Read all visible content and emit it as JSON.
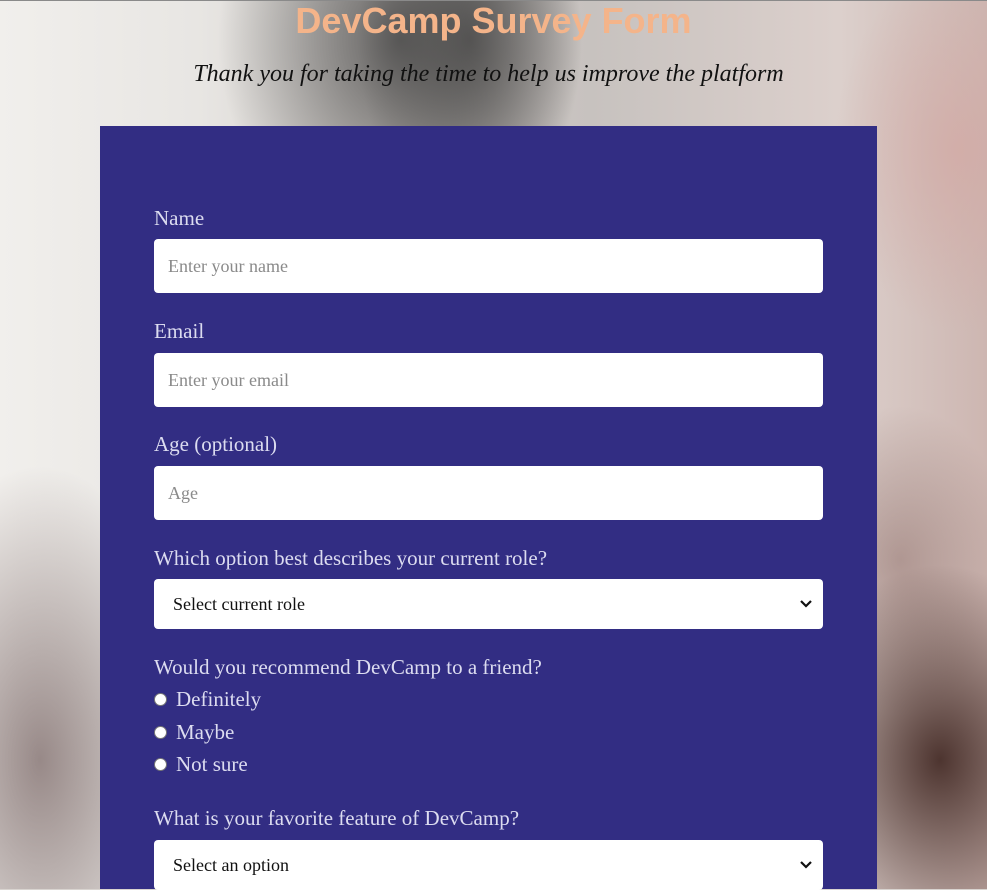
{
  "header": {
    "title": "DevCamp Survey Form",
    "subtitle": "Thank you for taking the time to help us improve the platform"
  },
  "form": {
    "name": {
      "label": "Name",
      "placeholder": "Enter your name"
    },
    "email": {
      "label": "Email",
      "placeholder": "Enter your email"
    },
    "age": {
      "label": "Age (optional)",
      "placeholder": "Age"
    },
    "role": {
      "label": "Which option best describes your current role?",
      "selected": "Select current role"
    },
    "recommend": {
      "label": "Would you recommend DevCamp to a friend?",
      "options": [
        "Definitely",
        "Maybe",
        "Not sure"
      ]
    },
    "feature": {
      "label": "What is your favorite feature of DevCamp?",
      "selected": "Select an option"
    }
  },
  "colors": {
    "title": "#f4b48a",
    "panel": "#322d83",
    "label": "#dcdcf0"
  }
}
